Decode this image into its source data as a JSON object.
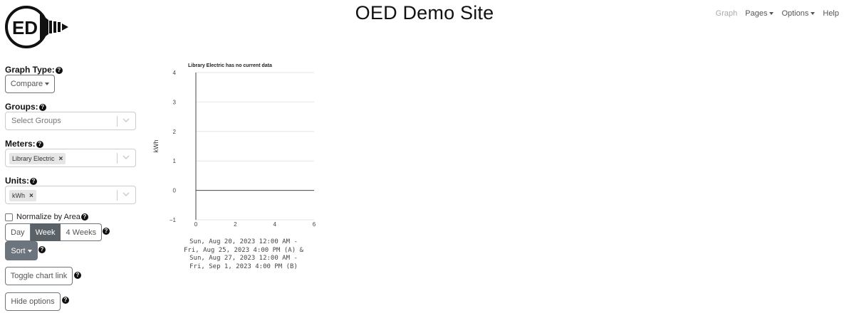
{
  "header": {
    "title": "OED Demo Site",
    "logo_text": "ED",
    "nav": {
      "graph": "Graph",
      "pages": "Pages",
      "options": "Options",
      "help": "Help"
    }
  },
  "controls": {
    "graph_type": {
      "label": "Graph Type:",
      "value": "Compare"
    },
    "groups": {
      "label": "Groups:",
      "placeholder": "Select Groups"
    },
    "meters": {
      "label": "Meters:",
      "selected": "Library Electric"
    },
    "units": {
      "label": "Units:",
      "selected": "kWh"
    },
    "normalize": {
      "label": "Normalize by Area",
      "checked": false
    },
    "interval": {
      "options": [
        "Day",
        "Week",
        "4 Weeks"
      ],
      "active": "Week"
    },
    "sort": "Sort",
    "toggle_chart_link": "Toggle chart link",
    "hide_options": "Hide options"
  },
  "chart_data": {
    "type": "line",
    "title": "Library Electric has no current data",
    "ylabel": "kWh",
    "ylim": [
      -1,
      4
    ],
    "xlim": [
      0,
      6
    ],
    "y_ticks": [
      "4",
      "3",
      "2",
      "1",
      "0",
      "−1"
    ],
    "x_ticks": [
      "0",
      "2",
      "4",
      "6"
    ],
    "series": [],
    "xlabel_lines": [
      "Sun, Aug 20, 2023 12:00 AM -",
      "Fri, Aug 25, 2023 4:00 PM (A) &",
      "Sun, Aug 27, 2023 12:00 AM -",
      "Fri, Sep 1, 2023 4:00 PM (B)"
    ],
    "colors": {
      "grid": "#e6e6e6",
      "axis": "#444444",
      "zero_line": "#444444"
    }
  }
}
